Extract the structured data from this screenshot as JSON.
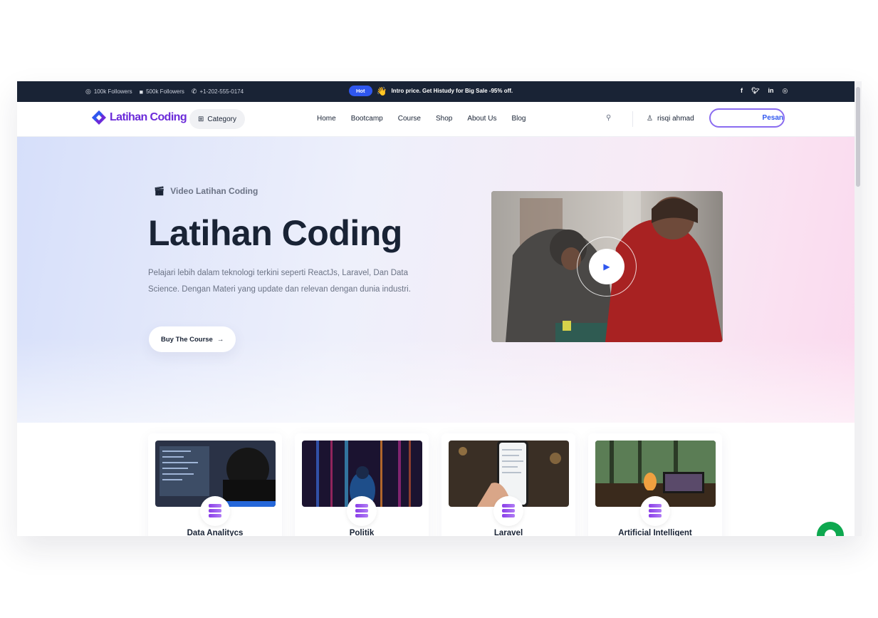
{
  "topbar": {
    "instagram_followers": "100k Followers",
    "facebook_followers": "500k Followers",
    "phone": "+1-202-555-0174",
    "hot_badge": "Hot",
    "promo_text": "Intro price. Get Histudy for Big Sale -95% off.",
    "social_icons": [
      "facebook-icon",
      "twitter-icon",
      "linkedin-icon",
      "instagram-icon"
    ]
  },
  "header": {
    "logo_text": "Latihan Coding",
    "category_label": "Category",
    "nav": [
      "Home",
      "Bootcamp",
      "Course",
      "Shop",
      "About Us",
      "Blog"
    ],
    "user_name": "risqi ahmad",
    "order_button": "Pesan"
  },
  "hero": {
    "pretitle": "Video Latihan Coding",
    "title": "Latihan Coding",
    "description": "Pelajari lebih dalam teknologi terkini seperti ReactJs, Laravel, Dan Data Science. Dengan Materi yang update dan relevan dengan dunia industri.",
    "cta_label": "Buy The Course"
  },
  "categories": [
    {
      "title": "Data Analitycs"
    },
    {
      "title": "Politik"
    },
    {
      "title": "Laravel"
    },
    {
      "title": "Artificial Intelligent"
    }
  ],
  "colors": {
    "topbar_bg": "#192335",
    "accent": "#2f57ef",
    "brand_purple": "#6b2bd9",
    "text_dark": "#192335",
    "text_muted": "#6b7385",
    "chat_green": "#0ea84f"
  }
}
